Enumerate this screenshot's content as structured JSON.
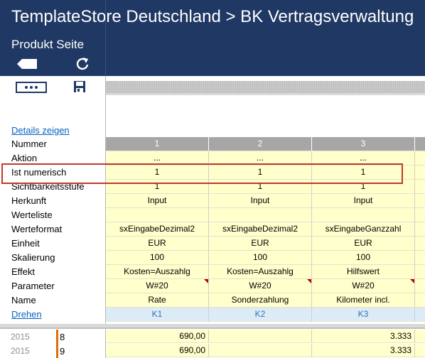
{
  "header": {
    "title": "TemplateStore Deutschland > BK  Vertragsverwaltung",
    "subtitle": "Produkt Seite",
    "icons": [
      "back-arrow-icon",
      "refresh-icon",
      "more-icon",
      "save-icon"
    ]
  },
  "sidebar": {
    "details_link": "Details zeigen",
    "labels": [
      "Nummer",
      "Aktion",
      "Ist numerisch",
      "Sichtbarkeitsstufe",
      "Herkunft",
      "Werteliste",
      "Werteformat",
      "Einheit",
      "Skalierung",
      "Effekt",
      "Parameter",
      "Name",
      "Drehen"
    ]
  },
  "grid": {
    "rows": [
      {
        "key": "nummer",
        "cells": [
          "1",
          "2",
          "3"
        ]
      },
      {
        "key": "aktion",
        "cells": [
          "...",
          "...",
          "..."
        ]
      },
      {
        "key": "ist_numerisch",
        "cells": [
          "1",
          "1",
          "1"
        ]
      },
      {
        "key": "sichtbarkeitsstufe",
        "cells": [
          "1",
          "1",
          "1"
        ]
      },
      {
        "key": "herkunft",
        "cells": [
          "Input",
          "Input",
          "Input"
        ]
      },
      {
        "key": "werteliste",
        "cells": [
          "",
          "",
          ""
        ]
      },
      {
        "key": "werteformat",
        "cells": [
          "sxEingabeDezimal2",
          "sxEingabeDezimal2",
          "sxEingabeGanzzahl"
        ]
      },
      {
        "key": "einheit",
        "cells": [
          "EUR",
          "EUR",
          "EUR"
        ]
      },
      {
        "key": "skalierung",
        "cells": [
          "100",
          "100",
          "100"
        ]
      },
      {
        "key": "effekt",
        "cells": [
          "Kosten=Auszahlg",
          "Kosten=Auszahlg",
          "Hilfswert"
        ]
      },
      {
        "key": "parameter",
        "cells": [
          "W#20",
          "W#20",
          "W#20"
        ]
      },
      {
        "key": "name",
        "cells": [
          "Rate",
          "Sonderzahlung",
          "Kilometer incl."
        ]
      },
      {
        "key": "drehen",
        "cells": [
          "K1",
          "K2",
          "K3"
        ]
      }
    ]
  },
  "body_rows": [
    {
      "year": "2015",
      "index": "8",
      "values": [
        "690,00",
        "",
        "3.333"
      ]
    },
    {
      "year": "2015",
      "index": "9",
      "values": [
        "690,00",
        "",
        "3.333"
      ]
    }
  ],
  "colors": {
    "header_bg": "#1f3864",
    "cell_yellow": "#ffffcc",
    "highlight_border": "#c0392b",
    "link_blue": "#0563c1"
  }
}
